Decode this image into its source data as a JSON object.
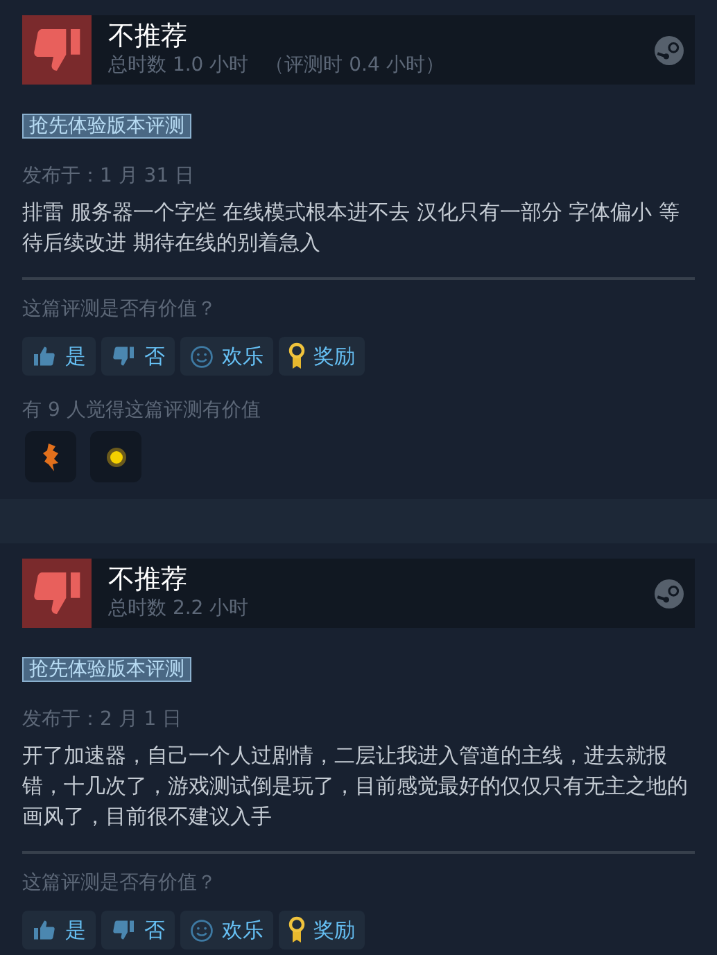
{
  "reviews": [
    {
      "verdict": "不推荐",
      "recommended": false,
      "hours": "总时数 1.0 小时",
      "hours_at_review": "（评测时 0.4 小时）",
      "tag": "抢先体验版本评测",
      "posted": "发布于：1 月 31 日",
      "body": "排雷 服务器一个字烂 在线模式根本进不去 汉化只有一部分 字体偏小 等待后续改进 期待在线的别着急入",
      "question": "这篇评测是否有价值？",
      "buttons": [
        {
          "kind": "yes",
          "label": "是"
        },
        {
          "kind": "no",
          "label": "否"
        },
        {
          "kind": "funny",
          "label": "欢乐"
        },
        {
          "kind": "award",
          "label": "奖励"
        }
      ],
      "helpful": "有 9 人觉得这篇评测有价值",
      "awards": [
        {
          "kind": "figure"
        },
        {
          "kind": "glow"
        }
      ]
    },
    {
      "verdict": "不推荐",
      "recommended": false,
      "hours": "总时数 2.2 小时",
      "tag": "抢先体验版本评测",
      "posted": "发布于：2 月 1 日",
      "body": "开了加速器，自己一个人过剧情，二层让我进入管道的主线，进去就报错，十几次了，游戏测试倒是玩了，目前感觉最好的仅仅只有无主之地的画风了，目前很不建议入手",
      "question": "这篇评测是否有价值？",
      "buttons": [
        {
          "kind": "yes",
          "label": "是"
        },
        {
          "kind": "no",
          "label": "否"
        },
        {
          "kind": "funny",
          "label": "欢乐"
        },
        {
          "kind": "award",
          "label": "奖励"
        }
      ]
    }
  ]
}
